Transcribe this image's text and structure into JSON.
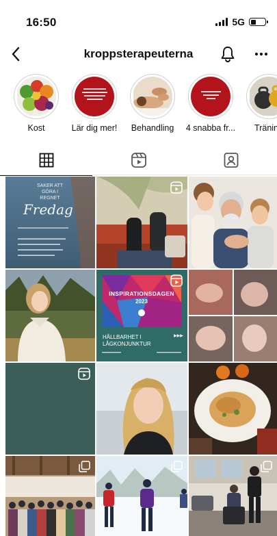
{
  "status_bar": {
    "time": "16:50",
    "network": "5G",
    "battery_level": 0.35
  },
  "header": {
    "username": "kroppsterapeuterna"
  },
  "highlights": [
    {
      "label": "Kost"
    },
    {
      "label": "Lär dig mer!"
    },
    {
      "label": "Behandling"
    },
    {
      "label": "4 snabba fr..."
    },
    {
      "label": "Träning"
    }
  ],
  "tabs": [
    {
      "name": "grid"
    },
    {
      "name": "reels"
    },
    {
      "name": "tagged"
    }
  ],
  "posts": {
    "p1": {
      "script": "Fredag",
      "line1": "SAKER ATT",
      "line2": "GÖRA I",
      "line3": "REGNET"
    },
    "p5": {
      "title": "INSPIRATIONSDAGEN",
      "year": "2023",
      "line1": "HÅLLBARHET I",
      "line2": "LÅGKONJUNKTUR"
    }
  },
  "colors": {
    "accent_red": "#b3141b",
    "teal": "#3c5e58",
    "navy": "#2d3a66"
  }
}
